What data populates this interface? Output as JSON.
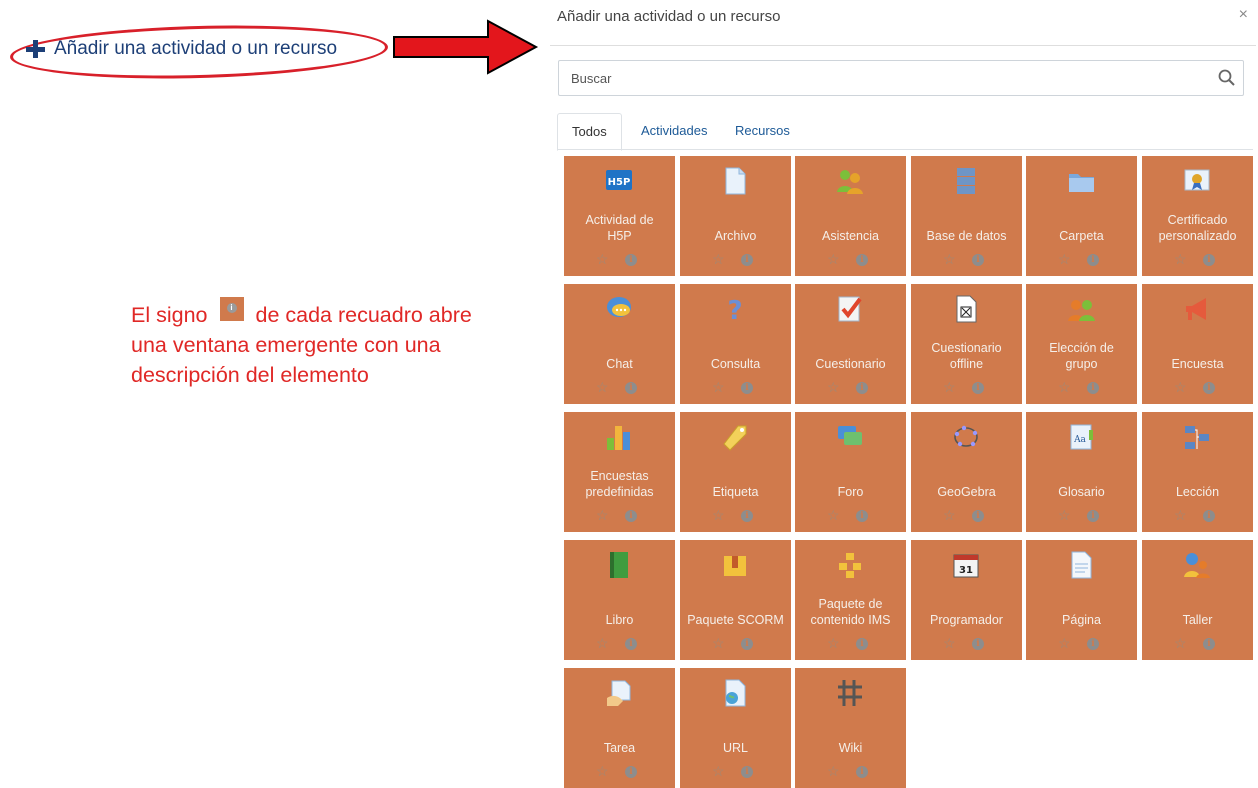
{
  "annotation": {
    "add_link_label": "Añadir una actividad o un recurso",
    "note_part1": "El signo",
    "note_part2": "de cada recuadro abre",
    "note_line2": "una ventana emergente con una",
    "note_line3": "descripción del elemento",
    "info_glyph": "i",
    "highlight_color": "#d8202a"
  },
  "modal": {
    "title": "Añadir una actividad o un recurso",
    "close": "×",
    "search_placeholder": "Buscar",
    "tabs": [
      {
        "label": "Todos",
        "active": true
      },
      {
        "label": "Actividades",
        "active": false
      },
      {
        "label": "Recursos",
        "active": false
      }
    ],
    "tile_color": "#d07a4c",
    "star_glyph": "☆",
    "info_glyph": "i",
    "tiles": [
      {
        "name": "Actividad de\nH5P",
        "icon": "h5p-icon"
      },
      {
        "name": "Archivo",
        "icon": "file-icon"
      },
      {
        "name": "Asistencia",
        "icon": "attendance-icon"
      },
      {
        "name": "Base de datos",
        "icon": "database-icon"
      },
      {
        "name": "Carpeta",
        "icon": "folder-icon"
      },
      {
        "name": "Certificado\npersonalizado",
        "icon": "certificate-icon"
      },
      {
        "name": "Chat",
        "icon": "chat-icon"
      },
      {
        "name": "Consulta",
        "icon": "question-icon"
      },
      {
        "name": "Cuestionario",
        "icon": "quiz-icon"
      },
      {
        "name": "Cuestionario\noffline",
        "icon": "offline-quiz-icon"
      },
      {
        "name": "Elección de\ngrupo",
        "icon": "group-choice-icon"
      },
      {
        "name": "Encuesta",
        "icon": "megaphone-icon"
      },
      {
        "name": "Encuestas\npredefinidas",
        "icon": "bar-chart-icon"
      },
      {
        "name": "Etiqueta",
        "icon": "tag-icon"
      },
      {
        "name": "Foro",
        "icon": "forum-icon"
      },
      {
        "name": "GeoGebra",
        "icon": "geogebra-icon"
      },
      {
        "name": "Glosario",
        "icon": "glossary-icon"
      },
      {
        "name": "Lección",
        "icon": "lesson-icon"
      },
      {
        "name": "Libro",
        "icon": "book-icon"
      },
      {
        "name": "Paquete SCORM",
        "icon": "scorm-icon"
      },
      {
        "name": "Paquete de\ncontenido IMS",
        "icon": "ims-icon"
      },
      {
        "name": "Programador",
        "icon": "calendar-icon"
      },
      {
        "name": "Página",
        "icon": "page-icon"
      },
      {
        "name": "Taller",
        "icon": "workshop-icon"
      },
      {
        "name": "Tarea",
        "icon": "assignment-icon"
      },
      {
        "name": "URL",
        "icon": "url-icon"
      },
      {
        "name": "Wiki",
        "icon": "wiki-icon"
      }
    ]
  }
}
